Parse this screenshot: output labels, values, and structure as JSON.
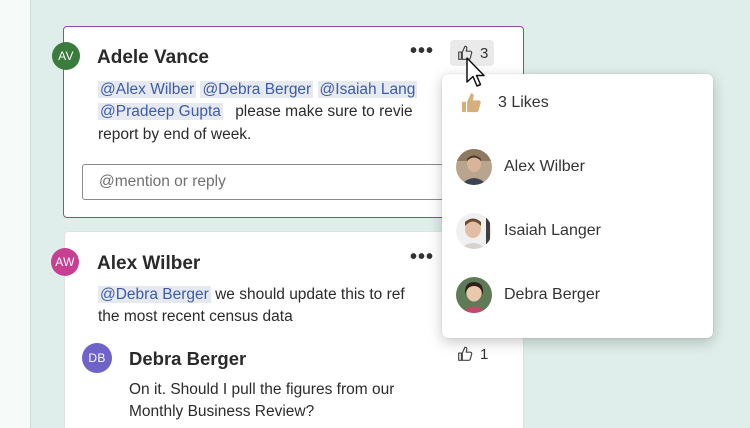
{
  "thread1": {
    "avatar_initials": "AV",
    "author": "Adele Vance",
    "more_label": "•••",
    "like_count": "3",
    "mentions": [
      "@Alex Wilber",
      "@Debra Berger",
      "@Isaiah Lang",
      "@Pradeep Gupta"
    ],
    "message_line2_text": "please make sure to revie",
    "message_line3": "report by end of week.",
    "reply_placeholder": "@mention or reply"
  },
  "likes_popup": {
    "header": "3 Likes",
    "people": [
      {
        "name": "Alex Wilber"
      },
      {
        "name": "Isaiah Langer"
      },
      {
        "name": "Debra Berger"
      }
    ]
  },
  "thread2": {
    "avatar_initials": "AW",
    "author": "Alex Wilber",
    "more_label": "•••",
    "mention": "@Debra Berger",
    "message_line1_text": " we should update this to ref",
    "message_line2": "the most recent census data"
  },
  "reply": {
    "avatar_initials": "DB",
    "author": "Debra Berger",
    "like_count": "1",
    "line1": "On it. Should I pull the figures from our",
    "line2": "Monthly Business Review?"
  },
  "colors": {
    "accent_border": "#8f4ba8",
    "mention_bg": "#e6e9f0",
    "mention_text": "#3c5ca8",
    "avatar_av": "#3a7c3b",
    "avatar_aw": "#c73f91",
    "avatar_db": "#6f63c9",
    "like_emoji": "#d6b07a"
  }
}
